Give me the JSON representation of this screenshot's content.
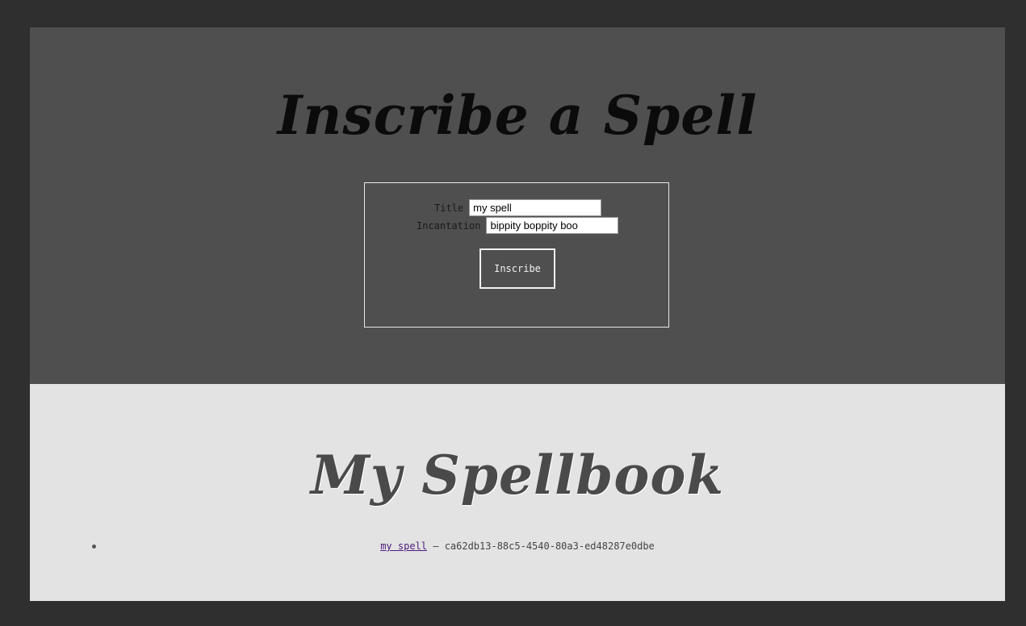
{
  "inscribe": {
    "heading": "Inscribe a Spell",
    "title_label": "Title",
    "title_value": "my spell",
    "incantation_label": "Incantation",
    "incantation_value": "bippity boppity boo",
    "submit_label": "Inscribe"
  },
  "spellbook": {
    "heading": "My Spellbook",
    "items": [
      {
        "title": "my spell",
        "separator": " — ",
        "id": "ca62db13-88c5-4540-80a3-ed48287e0dbe"
      }
    ]
  }
}
